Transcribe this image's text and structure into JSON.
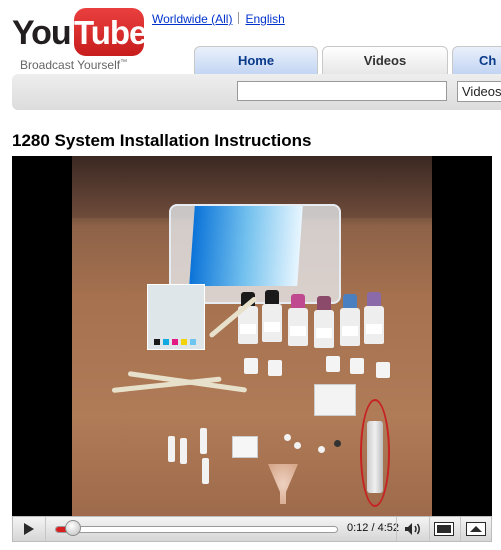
{
  "header": {
    "logo_you": "You",
    "logo_tube": "Tube",
    "tagline": "Broadcast Yourself",
    "tagline_tm": "™",
    "locale_country": "Worldwide (All)",
    "locale_language": "English"
  },
  "nav": {
    "tabs": [
      {
        "label": "Home"
      },
      {
        "label": "Videos"
      },
      {
        "label": "Ch"
      }
    ]
  },
  "search": {
    "value": "",
    "scope_selected": "Videos"
  },
  "video": {
    "title": "1280 System Installation Instructions"
  },
  "player": {
    "time_current": "0:12",
    "time_separator": "/",
    "time_total": "4:52",
    "progress_fraction": 0.041,
    "loaded_fraction": 0.041,
    "colors": {
      "played": "#d81f1f",
      "controls_bg": "#e6e6e6"
    },
    "icons": [
      "play-icon",
      "volume-icon",
      "theater-size-icon",
      "popout-menu-icon"
    ]
  }
}
